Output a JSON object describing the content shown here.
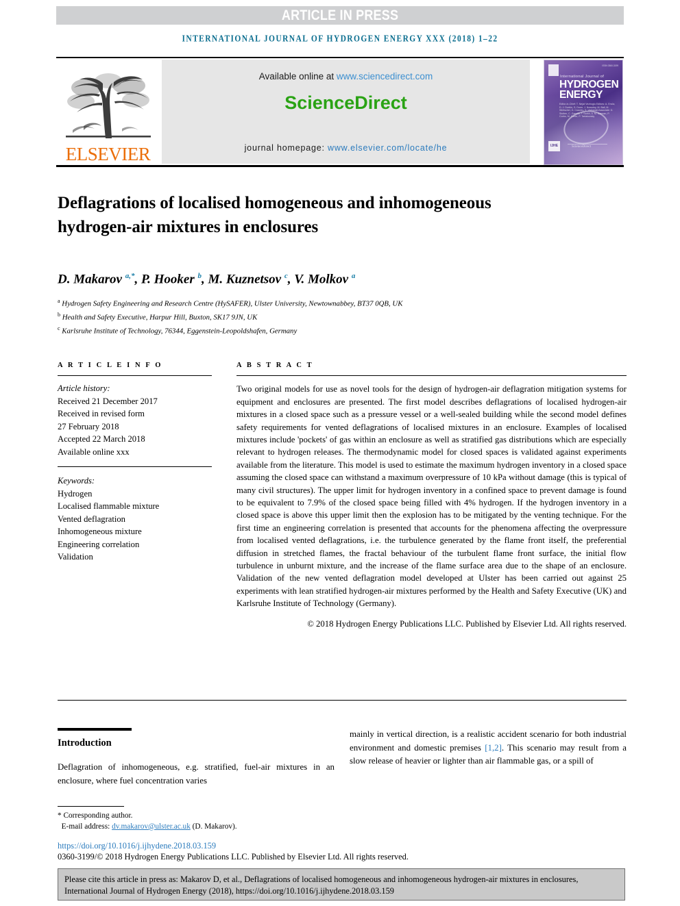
{
  "banner": {
    "label": "ARTICLE IN PRESS"
  },
  "running_head": {
    "text": "INTERNATIONAL JOURNAL OF HYDROGEN ENERGY XXX (2018) 1–22"
  },
  "masthead": {
    "publisher_wordmark": "ELSEVIER",
    "available_prefix": "Available online at ",
    "available_url": "www.sciencedirect.com",
    "sciencedirect_logo": "ScienceDirect",
    "homepage_prefix": "journal homepage: ",
    "homepage_url": "www.elsevier.com/locate/he",
    "cover": {
      "line_small": "International Journal of",
      "line1": "HYDROGEN",
      "line2": "ENERGY",
      "editors_block": "Editor-in-Chief: T. Nejat Veziroglu  Editors: A. Ersöz, D. J. Durbin, S. Dunn, J. Nowotny, M. Ball, M. Wietschel, G. Crawley, E. Varkaraki  Associate: D. Stolten, C. Gandía, F. Barbir, A. M. Kannan, P. Corbo, M. Conte, P. Tartakovsky",
      "top_right_mark": "ISSN 0360-3199",
      "publisher_mark": "ScienceDirect"
    },
    "colors": {
      "accent_teal": "#0b6e8f",
      "link_blue": "#2b7bbd",
      "sciencedirect_green": "#2aa314",
      "elsevier_orange": "#eb6e09",
      "banner_gray": "#cfd0d2"
    }
  },
  "article": {
    "title": "Deflagrations of localised homogeneous and inhomogeneous hydrogen-air mixtures in enclosures",
    "authors_html": "D. Makarov <sup>a,*</sup>, P. Hooker <sup>b</sup>, M. Kuznetsov <sup>c</sup>, V. Molkov <sup>a</sup>",
    "affiliations": [
      {
        "mark": "a",
        "text": "Hydrogen Safety Engineering and Research Centre (HySAFER), Ulster University, Newtownabbey, BT37 0QB, UK"
      },
      {
        "mark": "b",
        "text": "Health and Safety Executive, Harpur Hill, Buxton, SK17 9JN, UK"
      },
      {
        "mark": "c",
        "text": "Karlsruhe Institute of Technology, 76344, Eggenstein-Leopoldshafen, Germany"
      }
    ]
  },
  "article_info": {
    "heading": "A R T I C L E   I N F O",
    "history_label": "Article history:",
    "history": [
      "Received 21 December 2017",
      "Received in revised form",
      "27 February 2018",
      "Accepted 22 March 2018",
      "Available online xxx"
    ],
    "keywords_label": "Keywords:",
    "keywords": [
      "Hydrogen",
      "Localised flammable mixture",
      "Vented deflagration",
      "Inhomogeneous mixture",
      "Engineering correlation",
      "Validation"
    ]
  },
  "abstract": {
    "heading": "A B S T R A C T",
    "text": "Two original models for use as novel tools for the design of hydrogen-air deflagration mitigation systems for equipment and enclosures are presented. The first model describes deflagrations of localised hydrogen-air mixtures in a closed space such as a pressure vessel or a well-sealed building while the second model defines safety requirements for vented deflagrations of localised mixtures in an enclosure. Examples of localised mixtures include 'pockets' of gas within an enclosure as well as stratified gas distributions which are especially relevant to hydrogen releases. The thermodynamic model for closed spaces is validated against experiments available from the literature. This model is used to estimate the maximum hydrogen inventory in a closed space assuming the closed space can withstand a maximum overpressure of 10 kPa without damage (this is typical of many civil structures). The upper limit for hydrogen inventory in a confined space to prevent damage is found to be equivalent to 7.9% of the closed space being filled with 4% hydrogen. If the hydrogen inventory in a closed space is above this upper limit then the explosion has to be mitigated by the venting technique. For the first time an engineering correlation is presented that accounts for the phenomena affecting the overpressure from localised vented deflagrations, i.e. the turbulence generated by the flame front itself, the preferential diffusion in stretched flames, the fractal behaviour of the turbulent flame front surface, the initial flow turbulence in unburnt mixture, and the increase of the flame surface area due to the shape of an enclosure. Validation of the new vented deflagration model developed at Ulster has been carried out against 25 experiments with lean stratified hydrogen-air mixtures performed by the Health and Safety Executive (UK) and Karlsruhe Institute of Technology (Germany).",
    "copyright": "© 2018 Hydrogen Energy Publications LLC. Published by Elsevier Ltd. All rights reserved."
  },
  "body": {
    "section_heading": "Introduction",
    "left_paragraph": "Deflagration of inhomogeneous, e.g. stratified, fuel-air mixtures in an enclosure, where fuel concentration varies",
    "right_paragraph_part1": "mainly in vertical direction, is a realistic accident scenario for both industrial environment and domestic premises ",
    "right_reference": "[1,2]",
    "right_paragraph_part2": ". This scenario may result from a slow release of heavier or lighter than air flammable gas, or a spill of"
  },
  "footnotes": {
    "corresponding_author": "* Corresponding author.",
    "email_label": "E-mail address: ",
    "email": "dv.makarov@ulster.ac.uk",
    "email_suffix": " (D. Makarov).",
    "doi": "https://doi.org/10.1016/j.ijhydene.2018.03.159",
    "issn_line": "0360-3199/© 2018 Hydrogen Energy Publications LLC. Published by Elsevier Ltd. All rights reserved."
  },
  "cite_box": {
    "text": "Please cite this article in press as: Makarov D, et al., Deflagrations of localised homogeneous and inhomogeneous hydrogen-air mixtures in enclosures, International Journal of Hydrogen Energy (2018), https://doi.org/10.1016/j.ijhydene.2018.03.159"
  }
}
